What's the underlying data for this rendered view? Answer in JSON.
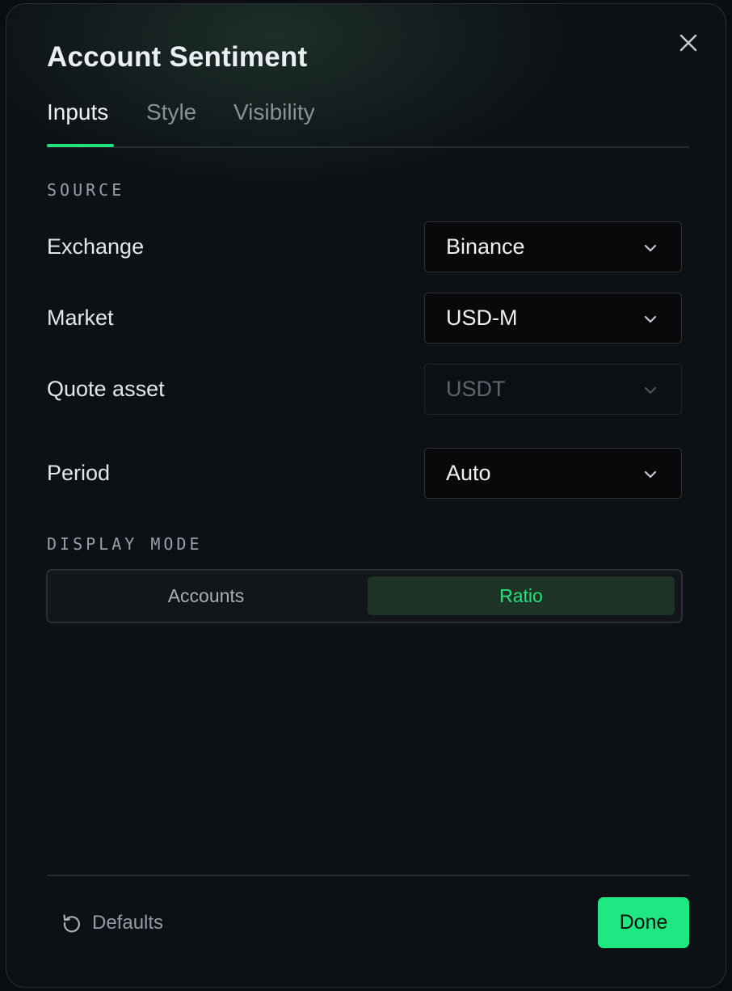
{
  "dialog": {
    "title": "Account Sentiment",
    "close_icon": "close-icon"
  },
  "tabs": [
    {
      "label": "Inputs",
      "active": true
    },
    {
      "label": "Style",
      "active": false
    },
    {
      "label": "Visibility",
      "active": false
    }
  ],
  "source": {
    "section_label": "SOURCE",
    "exchange": {
      "label": "Exchange",
      "value": "Binance"
    },
    "market": {
      "label": "Market",
      "value": "USD-M"
    },
    "quote_asset": {
      "label": "Quote asset",
      "value": "USDT",
      "disabled": true
    },
    "period": {
      "label": "Period",
      "value": "Auto"
    }
  },
  "display_mode": {
    "section_label": "DISPLAY MODE",
    "options": [
      "Accounts",
      "Ratio"
    ],
    "selected": "Ratio"
  },
  "footer": {
    "defaults_label": "Defaults",
    "defaults_icon": "reset-icon",
    "done_label": "Done"
  },
  "colors": {
    "accent": "#1fe882",
    "background": "#0d1116",
    "selected_segment_bg": "#1c3326"
  }
}
